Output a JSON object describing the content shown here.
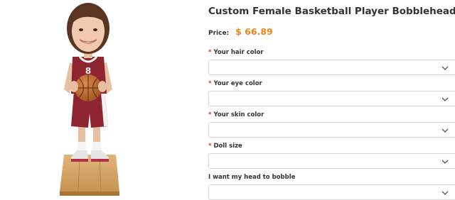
{
  "product": {
    "title": "Custom Female Basketball Player Bobbleheads",
    "price_label": "Price:",
    "price_value": "$ 66.89",
    "jersey_text": "8",
    "colors": {
      "price": "#f0841a",
      "required": "#e03030",
      "jersey": "#8e2430"
    }
  },
  "options": [
    {
      "required_mark": "*",
      "label": "Your hair color"
    },
    {
      "required_mark": "*",
      "label": "Your eye color"
    },
    {
      "required_mark": "*",
      "label": "Your skin color"
    },
    {
      "required_mark": "*",
      "label": "Doll size"
    },
    {
      "label": "I want my head to bobble"
    }
  ]
}
